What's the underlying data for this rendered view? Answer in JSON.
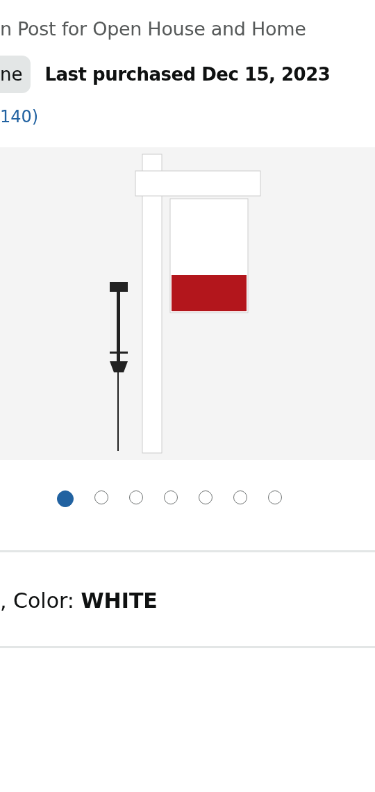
{
  "product_title": "n Post for Open House and Home",
  "badge": "ne",
  "purchase_note": "Last purchased Dec 15, 2023",
  "ratings_count": "140)",
  "carousel_dots": [
    {
      "selected": true
    },
    {
      "selected": false
    },
    {
      "selected": false
    },
    {
      "selected": false
    },
    {
      "selected": false
    },
    {
      "selected": false
    },
    {
      "selected": false
    }
  ],
  "variant": ", Color: **WHITE**"
}
